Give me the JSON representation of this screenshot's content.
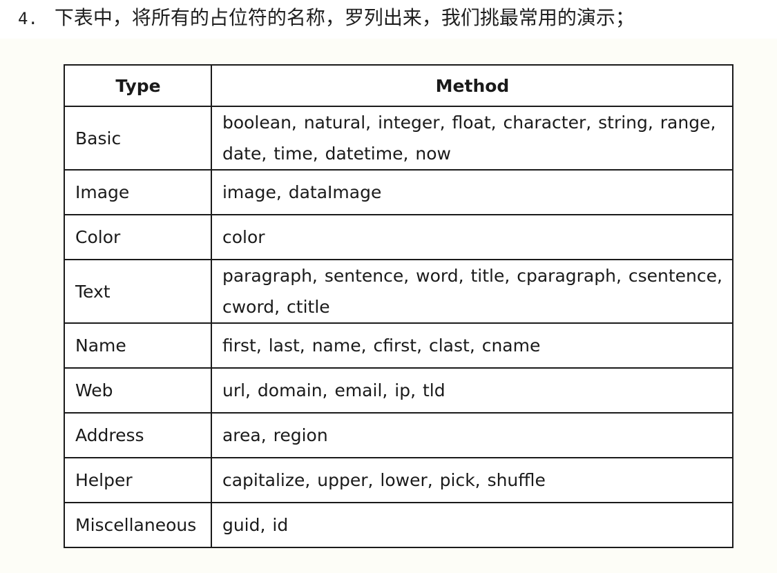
{
  "heading": {
    "number": "4.",
    "text": "下表中，将所有的占位符的名称，罗列出来，我们挑最常用的演示；"
  },
  "table": {
    "headers": [
      "Type",
      "Method"
    ],
    "rows": [
      {
        "type": "Basic",
        "method": "boolean, natural, integer, float, character, string, range, date, time, datetime, now"
      },
      {
        "type": "Image",
        "method": "image, dataImage"
      },
      {
        "type": "Color",
        "method": "color"
      },
      {
        "type": "Text",
        "method": "paragraph, sentence, word, title, cparagraph, csentence, cword, ctitle"
      },
      {
        "type": "Name",
        "method": "first, last, name, cfirst, clast, cname"
      },
      {
        "type": "Web",
        "method": "url, domain, email, ip, tld"
      },
      {
        "type": "Address",
        "method": "area, region"
      },
      {
        "type": "Helper",
        "method": "capitalize, upper, lower, pick, shuffle"
      },
      {
        "type": "Miscellaneous",
        "method": "guid, id"
      }
    ]
  }
}
